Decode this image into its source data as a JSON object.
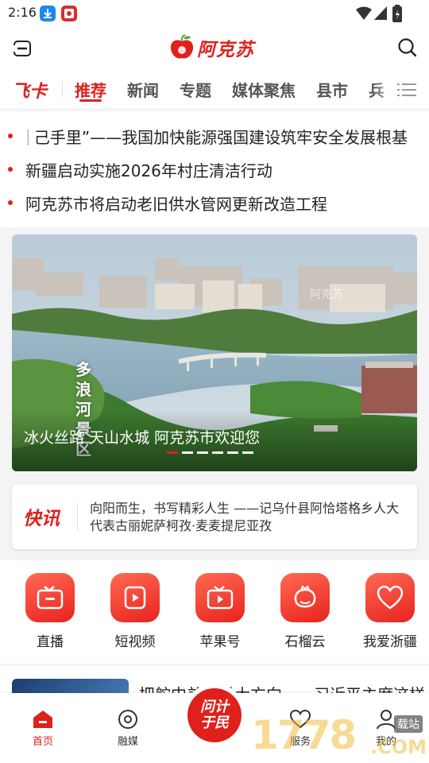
{
  "status_bar": {
    "time": "2:16"
  },
  "header": {
    "logo_text": "阿克苏"
  },
  "tabs": {
    "feika": "飞卡",
    "items": [
      "推荐",
      "新闻",
      "专题",
      "媒体聚焦",
      "县市",
      "兵"
    ]
  },
  "headlines": [
    "己手里”——我国加快能源强国建设筑牢安全发展根基",
    "新疆启动实施2026年村庄清洁行动",
    "阿克苏市将启动老旧供水管网更新改造工程"
  ],
  "banner": {
    "caption": "冰火丝路 天山水城 阿克苏市欢迎您",
    "overlay_vertical": [
      "多",
      "浪",
      "河",
      "景",
      "区"
    ],
    "watermark": "阿克苏",
    "indicator_count": 6,
    "indicator_active": 0
  },
  "flash": {
    "label": "快讯",
    "text": "向阳而生，书写精彩人生 ——记乌什县阿恰塔格乡人大代表古丽妮萨柯孜·麦麦提尼亚孜"
  },
  "services": [
    {
      "label": "直播",
      "icon": "live-tv-icon"
    },
    {
      "label": "短视频",
      "icon": "short-video-icon"
    },
    {
      "label": "苹果号",
      "icon": "apple-account-icon"
    },
    {
      "label": "石榴云",
      "icon": "pomegranate-icon"
    },
    {
      "label": "我爱浙疆",
      "icon": "heart-icon"
    }
  ],
  "peek_article": {
    "title": "把舵中美关系大方向——习近平主席这样"
  },
  "bottom_nav": {
    "home": "首页",
    "media": "融媒",
    "center_line1": "问计",
    "center_line2": "于民",
    "service": "服务",
    "mine": "我的"
  },
  "watermark": {
    "text": "1778",
    "suffix": ".COM",
    "tag": "载站"
  },
  "colors": {
    "brand_red": "#e0201b",
    "accent_orange": "#ff6a54"
  }
}
